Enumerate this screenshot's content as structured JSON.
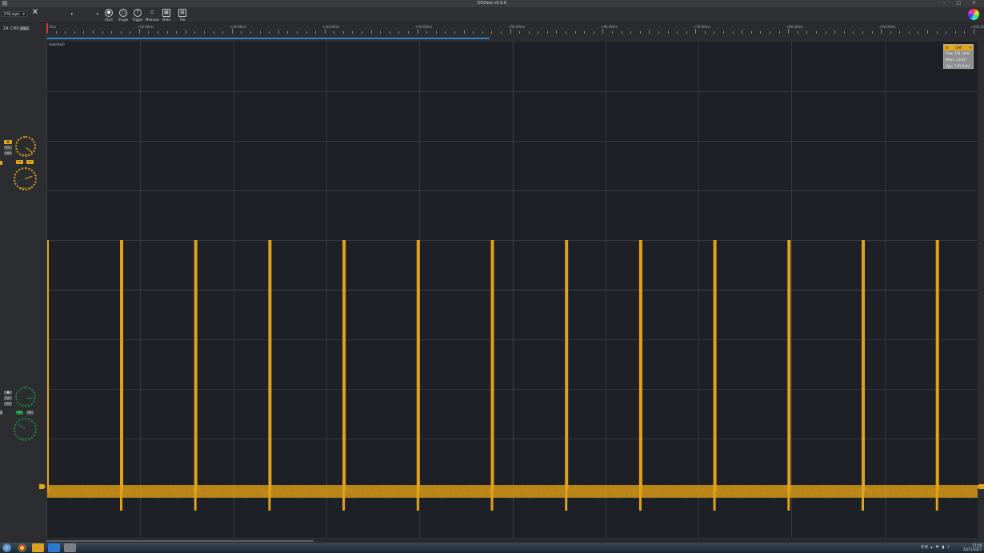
{
  "window": {
    "title": "DSView v0.9.6"
  },
  "toolbar": {
    "device": "DSLogic",
    "buttons": [
      {
        "label": "Start"
      },
      {
        "label": "Single"
      },
      {
        "label": "Trigger"
      },
      {
        "label": "Measure"
      },
      {
        "label": "Math"
      },
      {
        "label": "File"
      }
    ]
  },
  "channel_panel": {
    "ch0": {
      "label": "CH0",
      "knob_vdiv": "1V/div",
      "knob_offset": "Offset: 0V",
      "dc": "DC",
      "ac": "AC"
    },
    "ch1": {
      "label": "CH1",
      "knob_vdiv": "1V/div",
      "knob_offset": "Offset: 0V",
      "dc": "DC",
      "ac": "AC"
    },
    "header_label": "1A",
    "header_tag": "DSO"
  },
  "ruler": {
    "labels": [
      "0ms",
      "+10.00ms",
      "+20.00ms",
      "+30.00ms",
      "+40.00ms",
      "+50.00ms",
      "+60.00ms",
      "+70.00ms",
      "+80.00ms",
      "+90.00ms",
      "+100.00ms"
    ]
  },
  "plot": {
    "coupling_label": "Auto(Roll)"
  },
  "measure_box": {
    "title": "CH0",
    "rows": [
      "Freq: 101.1kHz",
      "Mean: 13.6V",
      "Vpp: 7.61.5mV"
    ]
  },
  "trace": {
    "color": "#e0a21a",
    "pulse_count": 12
  },
  "taskbar": {
    "lang": "EN",
    "time": "17:59",
    "date": "22/11/2017"
  }
}
